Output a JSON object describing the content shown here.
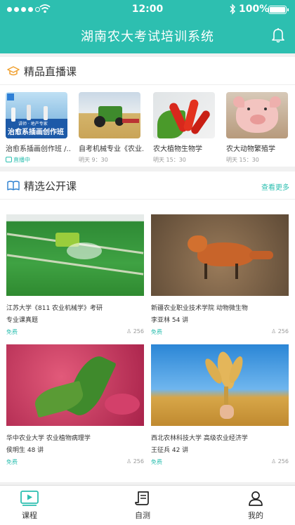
{
  "status": {
    "time": "12:00",
    "battery": "100%"
  },
  "app": {
    "title": "湖南农大考试培训系统"
  },
  "live": {
    "title": "精品直播课",
    "courses": [
      {
        "name": "治愈系插画创作班 /...",
        "sub": "直播中",
        "banner": "治愈系插画创作班",
        "banner_small": "讲师 · 地产专家"
      },
      {
        "name": "自考机械专业《农业...",
        "sub": "明天 9：30"
      },
      {
        "name": "农大植物生物学",
        "sub": "明天 15：30"
      },
      {
        "name": "农大动物繁殖学",
        "sub": "明天 15：30"
      }
    ]
  },
  "public": {
    "title": "精选公开课",
    "more": "查看更多",
    "courses": [
      {
        "line1": "江苏大学《811 农业机械学》考研",
        "line2": "专业课真题",
        "price": "免费",
        "views": "256"
      },
      {
        "line1": "新疆农业职业技术学院 动物微生物",
        "line2": "李亚林 54 讲",
        "price": "免费",
        "views": "256"
      },
      {
        "line1": "华中农业大学 农业植物病理学",
        "line2": "侯明生 48 讲",
        "price": "免费",
        "views": "256"
      },
      {
        "line1": "西北农林科技大学 高级农业经济学",
        "line2": "王征兵 42 讲",
        "price": "免费",
        "views": "256"
      }
    ]
  },
  "tabs": [
    {
      "label": "课程",
      "icon": "video-play-icon"
    },
    {
      "label": "自测",
      "icon": "scroll-icon"
    },
    {
      "label": "我的",
      "icon": "user-icon"
    }
  ],
  "colors": {
    "accent": "#2dbfb0"
  }
}
